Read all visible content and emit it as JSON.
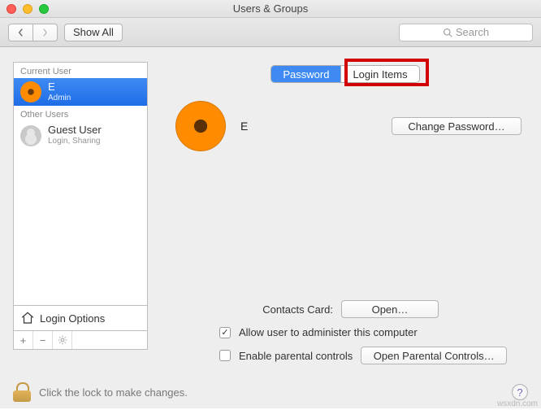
{
  "window": {
    "title": "Users & Groups"
  },
  "toolbar": {
    "show_all": "Show All",
    "search_placeholder": "Search"
  },
  "tabs": {
    "password": "Password",
    "login_items": "Login Items",
    "active": "password",
    "highlighted": "login_items"
  },
  "sidebar": {
    "current_user_label": "Current User",
    "other_users_label": "Other Users",
    "current_user": {
      "name": "E",
      "role": "Admin"
    },
    "guest": {
      "name": "Guest User",
      "sub": "Login, Sharing"
    },
    "login_options": "Login Options"
  },
  "main": {
    "display_name": "E",
    "change_password": "Change Password…",
    "contacts_card_label": "Contacts Card:",
    "open": "Open…",
    "allow_admin": "Allow user to administer this computer",
    "allow_admin_checked": true,
    "enable_parental": "Enable parental controls",
    "enable_parental_checked": false,
    "open_parental": "Open Parental Controls…"
  },
  "footer": {
    "lock_text": "Click the lock to make changes."
  },
  "watermark": "wsxdn.com"
}
